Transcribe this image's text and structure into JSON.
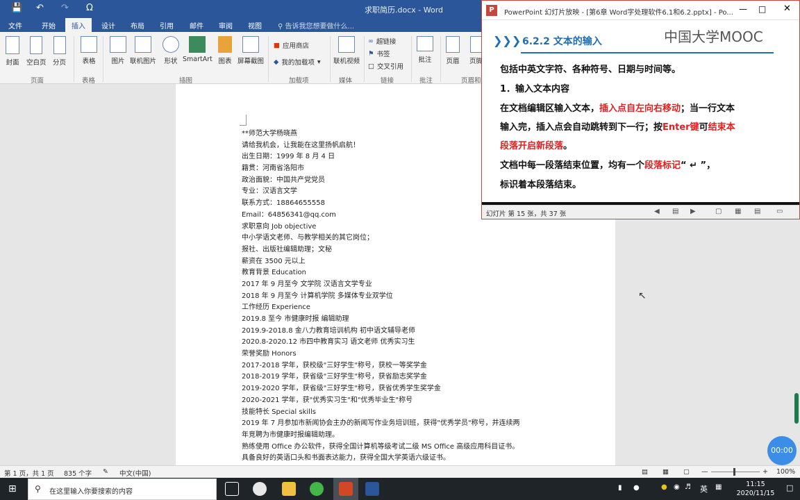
{
  "word": {
    "doc_title": "求职简历.docx - Word",
    "tabs": [
      "文件",
      "开始",
      "插入",
      "设计",
      "布局",
      "引用",
      "邮件",
      "审阅",
      "视图"
    ],
    "active_tab": "插入",
    "tell_me": "告诉我您想要做什么...",
    "ribbon": {
      "cover": "封面",
      "blank_page": "空白页",
      "page_break": "分页",
      "table": "表格",
      "picture": "图片",
      "online_picture": "联机图片",
      "shapes": "形状",
      "smartart": "SmartArt",
      "chart": "图表",
      "screenshot": "屏幕截图",
      "app_store": "应用商店",
      "my_addins": "我的加载项",
      "online_video": "联机视频",
      "hyperlink": "超链接",
      "bookmark": "书签",
      "cross_ref": "交叉引用",
      "comment": "批注",
      "header": "页眉",
      "footer": "页脚"
    },
    "groups": {
      "pages": "页面",
      "tables": "表格",
      "illustrations": "插图",
      "addins": "加载项",
      "media": "媒体",
      "links": "链接",
      "comments": "批注",
      "header_footer": "页眉和"
    },
    "doc_lines": [
      "**师范大学杨晓燕",
      "请给我机会，让我能在这里扬帆启航！",
      "出生日期：1999 年 8 月 4 日",
      "籍贯：河南省洛阳市",
      "政治面貌：中国共产党党员",
      "专业：汉语言文学",
      "联系方式：18864655558",
      "Email：64856341@qq.com",
      "求职意向 Job objective",
      "中小学语文老师、与教学相关的其它岗位；",
      "报社、出版社编辑助理；文秘",
      "薪资在 3500 元以上",
      "教育背景 Education",
      "2017 年 9 月至今 文学院 汉语言文学专业",
      "2018 年 9 月至今 计算机学院 多媒体专业双学位",
      "工作经历 Experience",
      "2019.8 至今 市健康时报 编辑助理",
      "2019.9-2018.8 金八力教育培训机构 初中语文辅导老师",
      "2020.8-2020.12 市四中教育实习 语文老师 优秀实习生",
      "荣誉奖励 Honors",
      "2017-2018 学年，获校级\"三好学生\"称号，获校一等奖学金",
      "2018-2019 学年，获省级\"三好学生\"称号，获省励志奖学金",
      "2019-2020 学年，获省级\"三好学生\"称号，获省优秀学生奖学金",
      "2020-2021 学年，获\"优秀实习生\"和\"优秀毕业生\"称号",
      "技能特长 Special skills",
      "2019 年 7 月参加市新闻协会主办的新闻写作业务培训班，获得\"优秀学员\"称号，并连续两",
      "年竞聘为市健康时报编辑助理。",
      "熟练使用 Office 办公软件，获得全国计算机等级考试二级 MS Office 高级应用科目证书。",
      "具备良好的英语口头和书面表达能力，获得全国大学英语六级证书。"
    ],
    "status": {
      "page": "第 1 页，共 1 页",
      "words": "835 个字",
      "lang": "中文(中国)",
      "zoom": "100%"
    }
  },
  "ppt": {
    "window_title": "PowerPoint 幻灯片放映 - [第6章 Word字处理软件6.1和6.2.pptx] - Po...",
    "slide_heading": "6.2.2  文本的输入",
    "mooc": "中国大学MOOC",
    "line1": "包括中英文字符、各种符号、日期与时间等。",
    "line2": "1．输入文本内容",
    "line3a": "在文档编辑区输入文本，",
    "line3b": "插入点自左向右移动",
    "line3c": "；当一行文本",
    "line4a": "输入完，插入点会自动跳转到下一行；按",
    "line4b": "Enter键",
    "line4c": "可",
    "line4d": "结束本",
    "line5": "段落开启新段落",
    "line5b": "。",
    "line6a": "文档中每一段落结束位置，均有一个",
    "line6b": "段落标记",
    "line6c": "“  ↵  ”，",
    "line7": "标识着本段落结束。",
    "slide_status": "幻灯片 第 15 张，共 37 张"
  },
  "taskbar": {
    "search_placeholder": "在这里输入你要搜索的内容",
    "time": "11:15",
    "date": "2020/11/15",
    "ime": "英"
  },
  "timer": "00:00"
}
